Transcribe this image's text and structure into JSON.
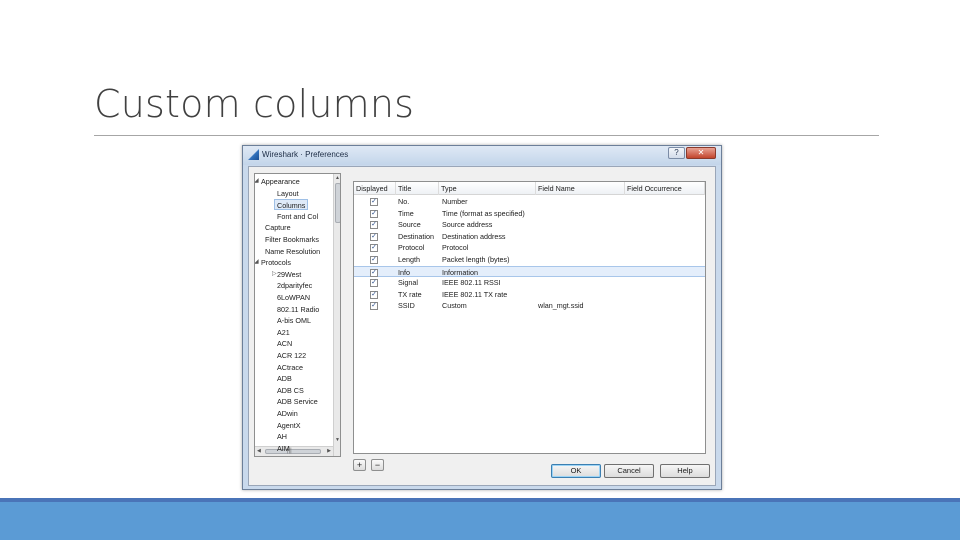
{
  "slide": {
    "title": "Custom columns"
  },
  "window": {
    "title": "Wireshark · Preferences",
    "help_glyph": "?",
    "close_glyph": "✕"
  },
  "tree": {
    "items": [
      {
        "label": "Appearance",
        "expanded": true
      },
      {
        "label": "Layout"
      },
      {
        "label": "Columns",
        "selected": true
      },
      {
        "label": "Font and Col"
      },
      {
        "label": "Capture"
      },
      {
        "label": "Filter Bookmarks"
      },
      {
        "label": "Name Resolution"
      },
      {
        "label": "Protocols",
        "expanded": true
      },
      {
        "label": "29West",
        "collapsed": true
      },
      {
        "label": "2dparityfec"
      },
      {
        "label": "6LoWPAN"
      },
      {
        "label": "802.11 Radio"
      },
      {
        "label": "A-bis OML"
      },
      {
        "label": "A21"
      },
      {
        "label": "ACN"
      },
      {
        "label": "ACR 122"
      },
      {
        "label": "ACtrace"
      },
      {
        "label": "ADB"
      },
      {
        "label": "ADB CS"
      },
      {
        "label": "ADB Service"
      },
      {
        "label": "ADwin"
      },
      {
        "label": "AgentX"
      },
      {
        "label": "AH"
      },
      {
        "label": "AIM"
      }
    ]
  },
  "columns_table": {
    "headers": [
      "Displayed",
      "Title",
      "Type",
      "Field Name",
      "Field Occurrence"
    ],
    "rows": [
      {
        "displayed": true,
        "title": "No.",
        "type": "Number",
        "field": "",
        "occurrence": ""
      },
      {
        "displayed": true,
        "title": "Time",
        "type": "Time (format as specified)",
        "field": "",
        "occurrence": ""
      },
      {
        "displayed": true,
        "title": "Source",
        "type": "Source address",
        "field": "",
        "occurrence": ""
      },
      {
        "displayed": true,
        "title": "Destination",
        "type": "Destination address",
        "field": "",
        "occurrence": ""
      },
      {
        "displayed": true,
        "title": "Protocol",
        "type": "Protocol",
        "field": "",
        "occurrence": ""
      },
      {
        "displayed": true,
        "title": "Length",
        "type": "Packet length (bytes)",
        "field": "",
        "occurrence": ""
      },
      {
        "displayed": true,
        "title": "Info",
        "type": "Information",
        "field": "",
        "occurrence": "",
        "selected": true
      },
      {
        "displayed": true,
        "title": "Signal",
        "type": "IEEE 802.11 RSSI",
        "field": "",
        "occurrence": ""
      },
      {
        "displayed": true,
        "title": "TX rate",
        "type": "IEEE 802.11 TX rate",
        "field": "",
        "occurrence": ""
      },
      {
        "displayed": true,
        "title": "SSID",
        "type": "Custom",
        "field": "wlan_mgt.ssid",
        "occurrence": ""
      }
    ]
  },
  "buttons": {
    "add": "+",
    "remove": "−",
    "ok": "OK",
    "cancel": "Cancel",
    "help": "Help"
  },
  "glyphs": {
    "check": "✓",
    "expanded_arrow": "◢",
    "collapsed_arrow": "▷",
    "scroll_up": "▲",
    "scroll_down": "▼",
    "scroll_left": "◀",
    "scroll_right": "▶",
    "grip": "|||"
  }
}
